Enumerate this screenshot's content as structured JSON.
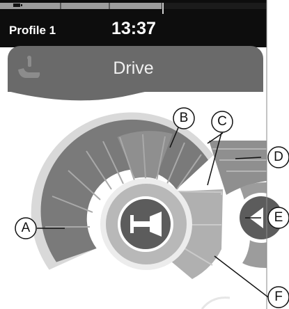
{
  "status_bar": {
    "profile_label": "Profile 1",
    "time": "13:37"
  },
  "mode_header": {
    "title": "Drive",
    "icon": "seat-icon"
  },
  "horn_button": {
    "icon": "horn-icon"
  },
  "callouts": {
    "a": "A",
    "b": "B",
    "c": "C",
    "d": "D",
    "e": "E",
    "f": "F"
  },
  "colors": {
    "status_bar": "#0d0d0d",
    "header_panel": "#6a6a6a",
    "gauge_dark": "#7a7a7a",
    "gauge_active_edge": "#8f8f8f",
    "gauge_light": "#b0b0b0",
    "gauge_track": "#d9d9d9",
    "horn_button": "#5c5c5c"
  }
}
